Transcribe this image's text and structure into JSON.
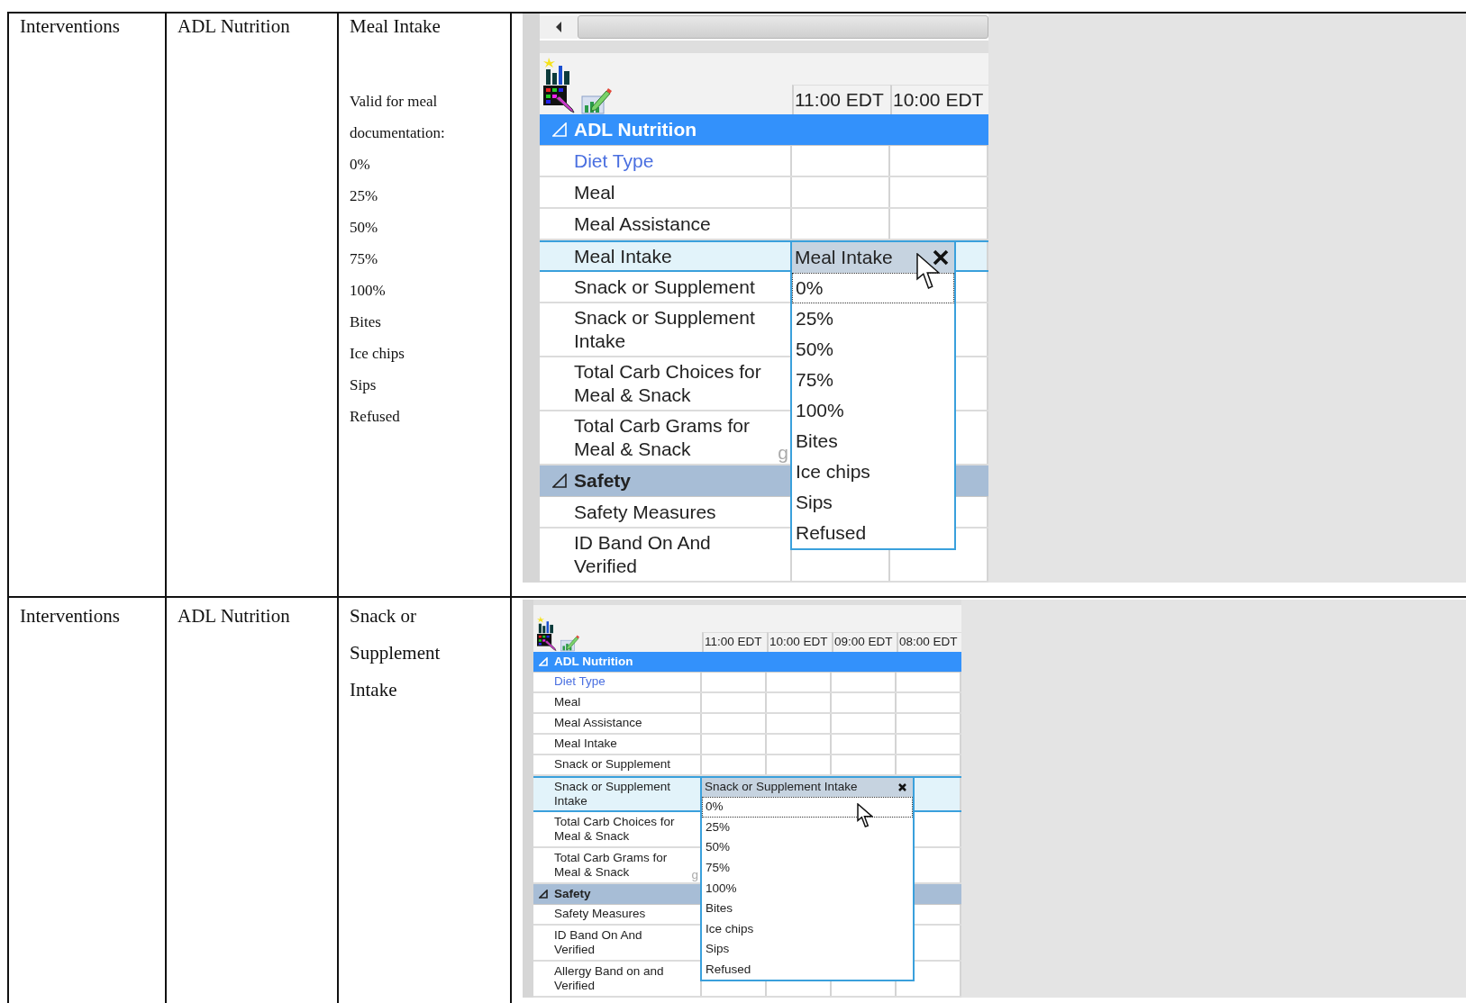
{
  "table": {
    "rows": [
      {
        "category": "Interventions",
        "group": "ADL Nutrition",
        "item": "Meal Intake",
        "notes": [
          "Valid for meal\ndocumentation:",
          "0%",
          "25%",
          "50%",
          "75%",
          "100%",
          "Bites",
          "Ice chips",
          "Sips",
          "Refused"
        ],
        "screenshot": {
          "scrollbar": true,
          "columns": [
            "11:00 EDT",
            "10:00 EDT"
          ],
          "rows": [
            {
              "kind": "section",
              "label": "ADL Nutrition",
              "expanded": true,
              "selected": true
            },
            {
              "kind": "item",
              "label": "Diet Type",
              "link": true,
              "selected": false
            },
            {
              "kind": "item",
              "label": "Meal",
              "selected": false
            },
            {
              "kind": "item",
              "label": "Meal Assistance",
              "selected": false
            },
            {
              "kind": "item",
              "label": "Meal Intake",
              "selected": true
            },
            {
              "kind": "item",
              "label": "Snack or Supplement",
              "selected": false
            },
            {
              "kind": "item",
              "label": "Snack or Supplement\nIntake",
              "selected": false
            },
            {
              "kind": "item",
              "label": "Total Carb Choices for\nMeal & Snack",
              "selected": false
            },
            {
              "kind": "item",
              "label": "Total Carb Grams for\nMeal & Snack",
              "unit": "g",
              "selected": false
            },
            {
              "kind": "section",
              "label": "Safety",
              "expanded": true,
              "selected": false
            },
            {
              "kind": "item",
              "label": "Safety Measures",
              "selected": false
            },
            {
              "kind": "item",
              "label": "ID Band On And\nVerified",
              "selected": false
            }
          ],
          "popup": {
            "title": "Meal Intake",
            "options": [
              {
                "label": "0%",
                "selected": true
              },
              {
                "label": "25%",
                "selected": false
              },
              {
                "label": "50%",
                "selected": false
              },
              {
                "label": "75%",
                "selected": false
              },
              {
                "label": "100%",
                "selected": false
              },
              {
                "label": "Bites",
                "selected": false
              },
              {
                "label": "Ice chips",
                "selected": false
              },
              {
                "label": "Sips",
                "selected": false
              },
              {
                "label": "Refused",
                "selected": false
              }
            ]
          }
        }
      },
      {
        "category": "Interventions",
        "group": "ADL Nutrition",
        "item": "Snack or\nSupplement\nIntake",
        "screenshot": {
          "columns": [
            "11:00 EDT",
            "10:00 EDT",
            "09:00 EDT",
            "08:00 EDT"
          ],
          "rows": [
            {
              "kind": "section",
              "label": "ADL Nutrition",
              "expanded": true,
              "selected": true
            },
            {
              "kind": "item",
              "label": "Diet Type",
              "link": true,
              "selected": false
            },
            {
              "kind": "item",
              "label": "Meal",
              "selected": false
            },
            {
              "kind": "item",
              "label": "Meal Assistance",
              "selected": false
            },
            {
              "kind": "item",
              "label": "Meal Intake",
              "selected": false
            },
            {
              "kind": "item",
              "label": "Snack or Supplement",
              "selected": false
            },
            {
              "kind": "item",
              "label": "Snack or Supplement\nIntake",
              "selected": true
            },
            {
              "kind": "item",
              "label": "Total Carb Choices for\nMeal & Snack",
              "selected": false
            },
            {
              "kind": "item",
              "label": "Total Carb Grams for\nMeal & Snack",
              "unit": "g",
              "selected": false
            },
            {
              "kind": "section",
              "label": "Safety",
              "expanded": true,
              "selected": false
            },
            {
              "kind": "item",
              "label": "Safety Measures",
              "selected": false
            },
            {
              "kind": "item",
              "label": "ID Band On And\nVerified",
              "selected": false
            },
            {
              "kind": "item",
              "label": "Allergy Band on and\nVerified",
              "selected": false
            }
          ],
          "popup": {
            "title": "Snack or Supplement Intake",
            "options": [
              {
                "label": "0%",
                "selected": true
              },
              {
                "label": "25%",
                "selected": false
              },
              {
                "label": "50%",
                "selected": false
              },
              {
                "label": "75%",
                "selected": false
              },
              {
                "label": "100%",
                "selected": false
              },
              {
                "label": "Bites",
                "selected": false
              },
              {
                "label": "Ice chips",
                "selected": false
              },
              {
                "label": "Sips",
                "selected": false
              },
              {
                "label": "Refused",
                "selected": false
              }
            ]
          }
        }
      }
    ]
  }
}
